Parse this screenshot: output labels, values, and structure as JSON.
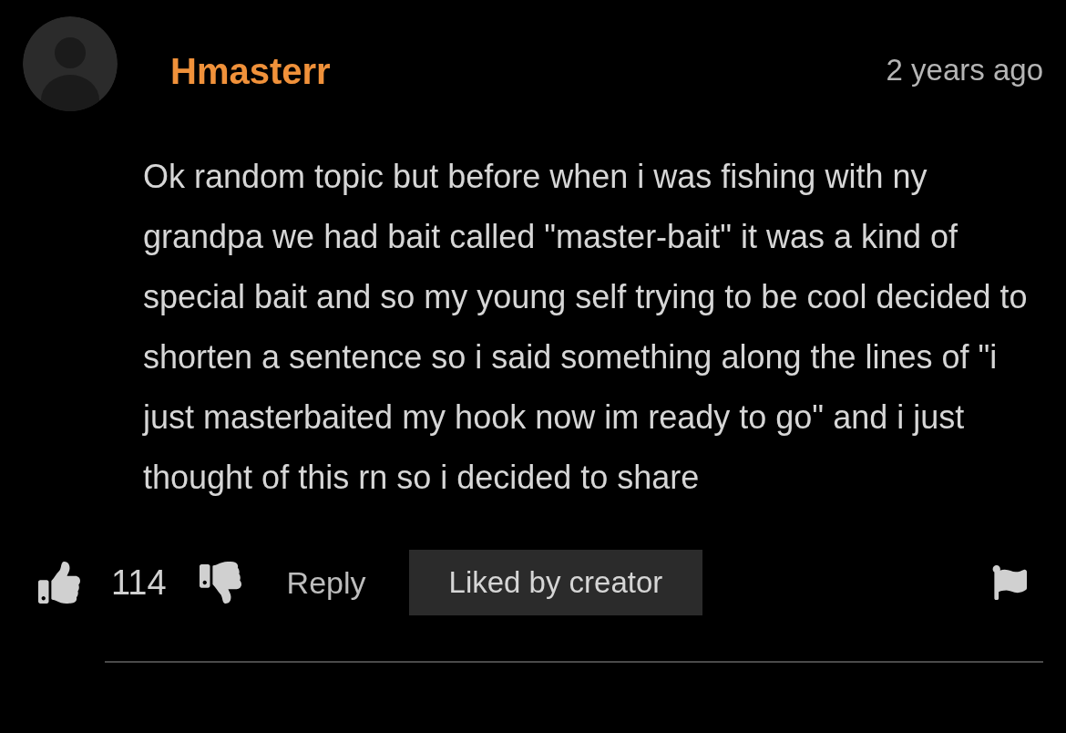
{
  "comment": {
    "author": "Hmasterr",
    "time": "2 years ago",
    "text": "Ok random topic but before when i was fishing with ny grandpa we had bait called \"master-bait\" it was a kind of special bait and so my young self trying to be cool decided to shorten a sentence so i said something along the lines of \"i just masterbaited my hook now im ready to go\" and i just thought of this rn so i decided to share",
    "likes": "114",
    "reply": "Reply",
    "badge": "Liked by creator"
  }
}
